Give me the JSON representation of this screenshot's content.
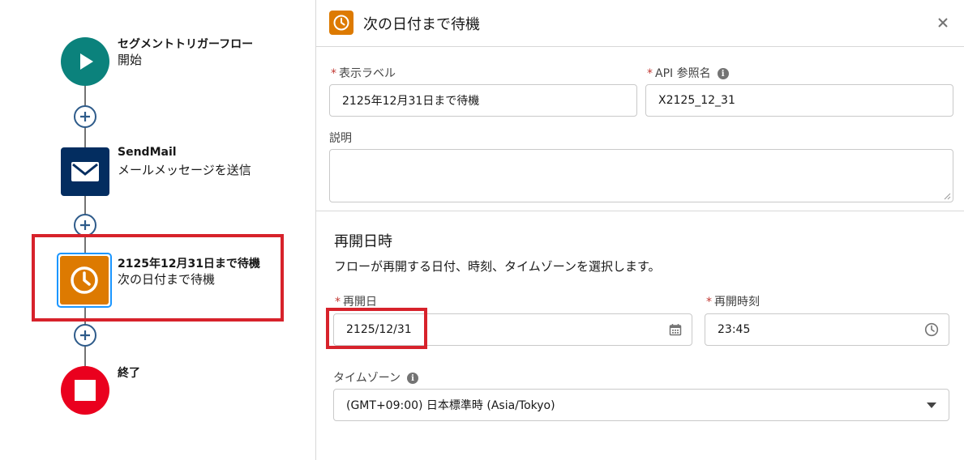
{
  "canvas": {
    "nodes": [
      {
        "title": "セグメントトリガーフロー",
        "subtitle": "開始",
        "icon": "play-icon",
        "color": "#0b827c"
      },
      {
        "title": "SendMail",
        "subtitle": "メールメッセージを送信",
        "icon": "envelope-icon",
        "color": "#032d60"
      },
      {
        "title": "2125年12月31日まで待機",
        "subtitle": "次の日付まで待機",
        "icon": "clock-icon",
        "color": "#dd7a01"
      },
      {
        "title": "終了",
        "subtitle": "",
        "icon": "stop-icon",
        "color": "#ea001e"
      }
    ],
    "highlight_color": "#d7222b"
  },
  "panel": {
    "title": "次の日付まで待機",
    "header_icon": "clock-icon",
    "close_icon": "close-icon",
    "required_marker": "*",
    "label_field": {
      "label": "表示ラベル",
      "value": "2125年12月31日まで待機"
    },
    "api_field": {
      "label": "API 参照名",
      "value": "X2125_12_31"
    },
    "description_field": {
      "label": "説明",
      "value": ""
    },
    "resume_section": {
      "title": "再開日時",
      "description": "フローが再開する日付、時刻、タイムゾーンを選択します。",
      "date_field": {
        "label": "再開日",
        "value": "2125/12/31",
        "icon": "calendar-icon"
      },
      "time_field": {
        "label": "再開時刻",
        "value": "23:45",
        "icon": "clock-icon"
      },
      "timezone_field": {
        "label": "タイムゾーン",
        "value": "(GMT+09:00) 日本標準時 (Asia/Tokyo)",
        "icon": "dropdown-arrow-icon"
      }
    }
  }
}
